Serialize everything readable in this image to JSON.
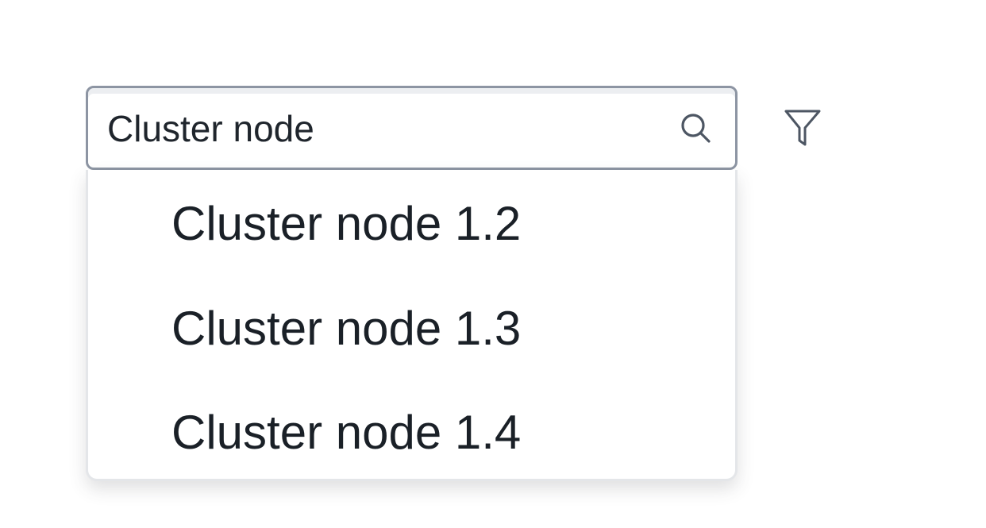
{
  "search": {
    "value": "Cluster node",
    "icon": "search-icon"
  },
  "filter": {
    "icon": "funnel-filter-icon"
  },
  "dropdown": {
    "items": [
      {
        "label": "Cluster node 1.2"
      },
      {
        "label": "Cluster node 1.3"
      },
      {
        "label": "Cluster node 1.4"
      }
    ]
  },
  "colors": {
    "border": "#8d95a3",
    "text": "#1f252c",
    "dropdown_border": "#e4e6e9",
    "background": "#ffffff"
  }
}
